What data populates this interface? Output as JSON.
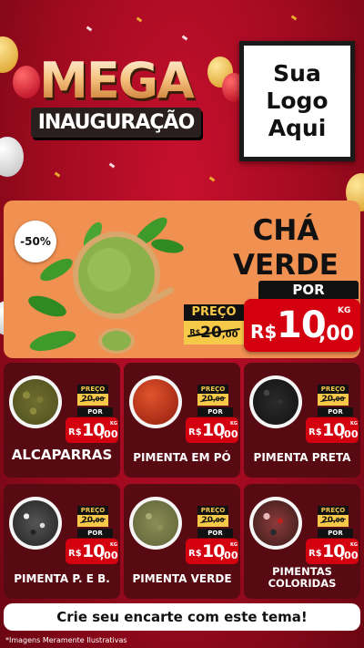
{
  "header": {
    "mega": "MEGA",
    "inauguracao": "INAUGURAÇÃO",
    "logo_line1": "Sua Logo",
    "logo_line2": "Aqui"
  },
  "featured": {
    "discount": "-50%",
    "name_line1": "CHÁ",
    "name_line2": "VERDE",
    "preco_label": "PREÇO",
    "old_currency": "R$",
    "old_price": "20",
    "old_cents": ",00",
    "por_label": "POR",
    "currency": "R$",
    "price": "10",
    "cents": ",00",
    "unit": "KG"
  },
  "products": [
    {
      "name": "ALCAPARRAS",
      "preco_label": "PREÇO",
      "old_price": "20",
      "old_cents": ",00",
      "por_label": "POR",
      "currency": "R$",
      "price": "10",
      "cents": ",00",
      "unit": "KG"
    },
    {
      "name": "PIMENTA EM PÓ",
      "preco_label": "PREÇO",
      "old_price": "20",
      "old_cents": ",00",
      "por_label": "POR",
      "currency": "R$",
      "price": "10",
      "cents": ",00",
      "unit": "KG"
    },
    {
      "name": "PIMENTA PRETA",
      "preco_label": "PREÇO",
      "old_price": "20",
      "old_cents": ",00",
      "por_label": "POR",
      "currency": "R$",
      "price": "10",
      "cents": ",00",
      "unit": "KG"
    },
    {
      "name": "PIMENTA P. E B.",
      "preco_label": "PREÇO",
      "old_price": "20",
      "old_cents": ",00",
      "por_label": "POR",
      "currency": "R$",
      "price": "10",
      "cents": ",00",
      "unit": "KG"
    },
    {
      "name": "PIMENTA VERDE",
      "preco_label": "PREÇO",
      "old_price": "20",
      "old_cents": ",00",
      "por_label": "POR",
      "currency": "R$",
      "price": "10",
      "cents": ",00",
      "unit": "KG"
    },
    {
      "name_line1": "PIMENTAS",
      "name_line2": "COLORIDAS",
      "preco_label": "PREÇO",
      "old_price": "20",
      "old_cents": ",00",
      "por_label": "POR",
      "currency": "R$",
      "price": "10",
      "cents": ",00",
      "unit": "KG"
    }
  ],
  "cta": "Crie seu encarte com este tema!",
  "disclaimer": "*Imagens Meramente Ilustrativas",
  "colors": {
    "background": "#b00c22",
    "featured_bg": "#f09051",
    "card_bg": "#570a12",
    "price_red": "#d4000f",
    "old_price_yellow": "#f7c948"
  }
}
